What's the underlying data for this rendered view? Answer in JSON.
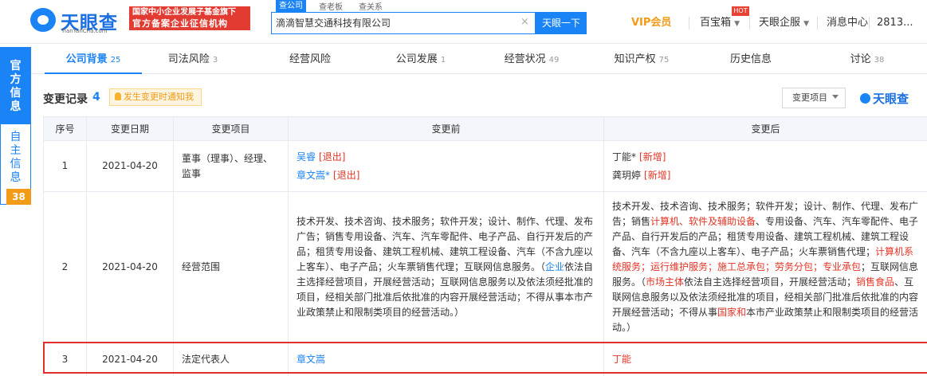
{
  "header": {
    "logo_text": "天眼查",
    "logo_sub": "TianYanCha.com",
    "badge_line1": "国家中小企业发展子基金旗下",
    "badge_line2": "官方备案企业征信机构",
    "scope_tabs": [
      "查公司",
      "查老板",
      "查关系"
    ],
    "search_value": "滴滴智慧交通科技有限公司",
    "search_button": "天眼一下",
    "vip": "VIP会员",
    "baobao": "百宝箱",
    "hot": "HOT",
    "qifu": "天眼企服",
    "messages": "消息中心",
    "user": "2813..."
  },
  "side": {
    "official": "官方信息",
    "self": "自主信息",
    "count": "38"
  },
  "tabs": [
    {
      "label": "公司背景",
      "count": "25"
    },
    {
      "label": "司法风险",
      "count": "3"
    },
    {
      "label": "经营风险",
      "count": ""
    },
    {
      "label": "公司发展",
      "count": "1"
    },
    {
      "label": "经营状况",
      "count": "49"
    },
    {
      "label": "知识产权",
      "count": "75"
    },
    {
      "label": "历史信息",
      "count": ""
    },
    {
      "label": "讨论",
      "count": "38"
    }
  ],
  "section": {
    "title": "变更记录",
    "count": "4",
    "notice": "发生变更时通知我",
    "filter": "变更项目",
    "watermark": "天眼查"
  },
  "table": {
    "headers": [
      "序号",
      "变更日期",
      "变更项目",
      "变更前",
      "变更后"
    ],
    "rows": [
      {
        "idx": "1",
        "date": "2021-04-20",
        "item": "董事（理事）、经理、监事"
      },
      {
        "idx": "2",
        "date": "2021-04-20",
        "item": "经营范围"
      },
      {
        "idx": "3",
        "date": "2021-04-20",
        "item": "法定代表人"
      }
    ],
    "row1_before": [
      {
        "name": "吴睿",
        "tag": "[退出]"
      },
      {
        "name": "章文嵩*",
        "tag": "[退出]"
      }
    ],
    "row1_after": [
      {
        "name": "丁能*",
        "tag": "[新增]"
      },
      {
        "name": "龚玥婷",
        "tag": "[新增]"
      }
    ],
    "row2_before": [
      {
        "text": "技术开发、技术咨询、技术服务；软件开发；设计、制作、代理、发布广告；销售专用设备、汽车、汽车零配件、电子产品、自行开发后的产品；租赁专用设备、建筑工程机械、建筑工程设备、汽车（不含九座以上客车）、电子产品；火车票销售代理；互联网信息服务。（",
        "red": false
      },
      {
        "text": "企业",
        "red": true
      },
      {
        "text": "依法自主选择经营项目，开展经营活动；互联网信息服务以及依法须经批准的项目，经相关部门批准后依批准的内容开展经营活动；不得从事本市产业政策禁止和限制类项目的经营活动。）",
        "red": false
      }
    ],
    "row2_after": [
      {
        "text": "技术开发、技术咨询、技术服务；软件开发；设计、制作、代理、发布广告；销售",
        "red": false
      },
      {
        "text": "计算机、软件及辅助设备",
        "red": true
      },
      {
        "text": "、专用设备、汽车、汽车零配件、电子产品、自行开发后的产品；租赁专用设备、建筑工程机械、建筑工程设备、汽车（不含九座以上客车）、电子产品；火车票销售代理；",
        "red": false
      },
      {
        "text": "计算机系统服务；运行维护服务；施工总承包；劳务分包；专业承包",
        "red": true
      },
      {
        "text": "；互联网信息服务。（",
        "red": false
      },
      {
        "text": "市场主体",
        "red": true
      },
      {
        "text": "依法自主选择经营项目，开展经营活动；",
        "red": false
      },
      {
        "text": "销售食品",
        "red": true
      },
      {
        "text": "、互联网信息服务以及依法须经批准的项目，经相关部门批准后依批准的内容开展经营活动；不得从事",
        "red": false
      },
      {
        "text": "国家和",
        "red": true
      },
      {
        "text": "本市产业政策禁止和限制类项目的经营活动。）",
        "red": false
      }
    ],
    "row3_before": "章文嵩",
    "row3_after": "丁能"
  },
  "colors": {
    "accent": "#1a83f6",
    "red": "#e63426",
    "vip": "#f39a17",
    "badge_bg": "#e23b32"
  }
}
